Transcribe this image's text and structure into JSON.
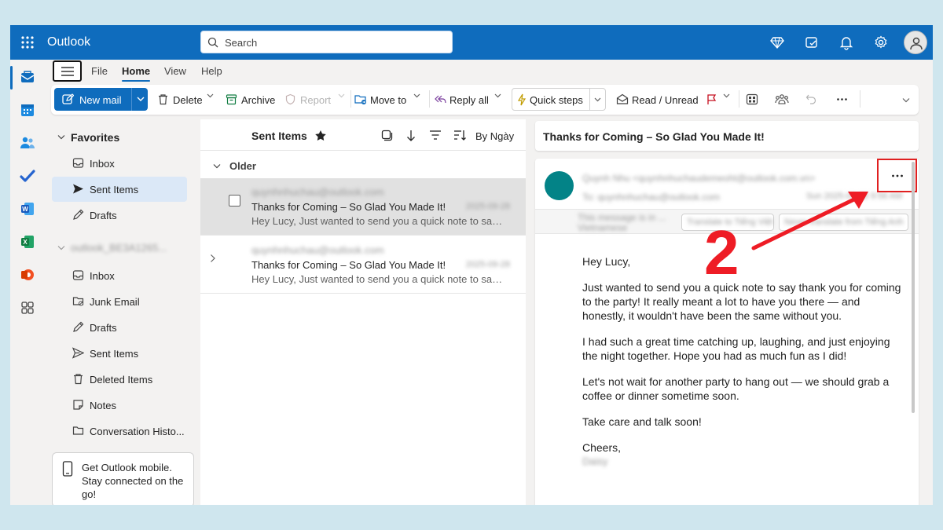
{
  "app": {
    "name": "Outlook",
    "accent": "#0f6cbd"
  },
  "search": {
    "placeholder": "Search"
  },
  "menu": {
    "file": "File",
    "home": "Home",
    "view": "View",
    "help": "Help"
  },
  "ribbon": {
    "new_mail": "New mail",
    "delete": "Delete",
    "archive": "Archive",
    "report": "Report",
    "move_to": "Move to",
    "reply_all": "Reply all",
    "quick_steps": "Quick steps",
    "read_unread": "Read / Unread"
  },
  "nav": {
    "favorites_header": "Favorites",
    "favorites": [
      {
        "label": "Inbox",
        "icon": "inbox-icon"
      },
      {
        "label": "Sent Items",
        "icon": "send-icon",
        "selected": true
      },
      {
        "label": "Drafts",
        "icon": "pencil-icon"
      }
    ],
    "account_header": "outlook_BE3A1265...",
    "folders": [
      {
        "label": "Inbox",
        "icon": "inbox-icon"
      },
      {
        "label": "Junk Email",
        "icon": "junk-icon"
      },
      {
        "label": "Drafts",
        "icon": "pencil-icon"
      },
      {
        "label": "Sent Items",
        "icon": "send-icon"
      },
      {
        "label": "Deleted Items",
        "icon": "trash-icon"
      },
      {
        "label": "Notes",
        "icon": "note-icon"
      },
      {
        "label": "Conversation Histo..."
      }
    ],
    "promo": "Get Outlook mobile. Stay connected on the go!"
  },
  "list": {
    "title": "Sent Items",
    "sort": "By Ngày",
    "group": "Older",
    "messages": [
      {
        "sender": "quynhnhuchau@outlook.com",
        "subject": "Thanks for Coming – So Glad You Made It!",
        "preview": "Hey Lucy, Just wanted to send you a quick note to say t...",
        "date": "2025-09-28",
        "selected": true
      },
      {
        "sender": "quynhnhuchau@outlook.com",
        "subject": "Thanks for Coming – So Glad You Made It!",
        "preview": "Hey Lucy, Just wanted to send you a quick note to say t...",
        "date": "2025-09-28",
        "selected": false
      }
    ]
  },
  "reading": {
    "subject": "Thanks for Coming – So Glad You Made It!",
    "from": "Quynh Nhu <quynhnhuchaudemeoht@outlook.com.vn>",
    "to": "To: quynhnhuchau@outlook.com",
    "time": "Sun 2025-09-28 9:56 AM",
    "info": "This message is in ...",
    "info2": "Vietnamese",
    "translate_btn": "Translate to Tiếng Việt",
    "never_btn": "Never translate from Tiếng Anh",
    "greeting": "Hey Lucy,",
    "p1": "Just wanted to send you a quick note to say thank you for coming to the party! It really meant a lot to have you there — and honestly, it wouldn't have been the same without you.",
    "p2": "I had such a great time catching up, laughing, and just enjoying the night together. Hope you had as much fun as I did!",
    "p3": "Let's not wait for another party to hang out — we should grab a coffee or dinner sometime soon.",
    "p4": "Take care and talk soon!",
    "closing": "Cheers,",
    "signature": "Daisy"
  },
  "annotation": {
    "step": "2",
    "color": "#ee1c25"
  }
}
